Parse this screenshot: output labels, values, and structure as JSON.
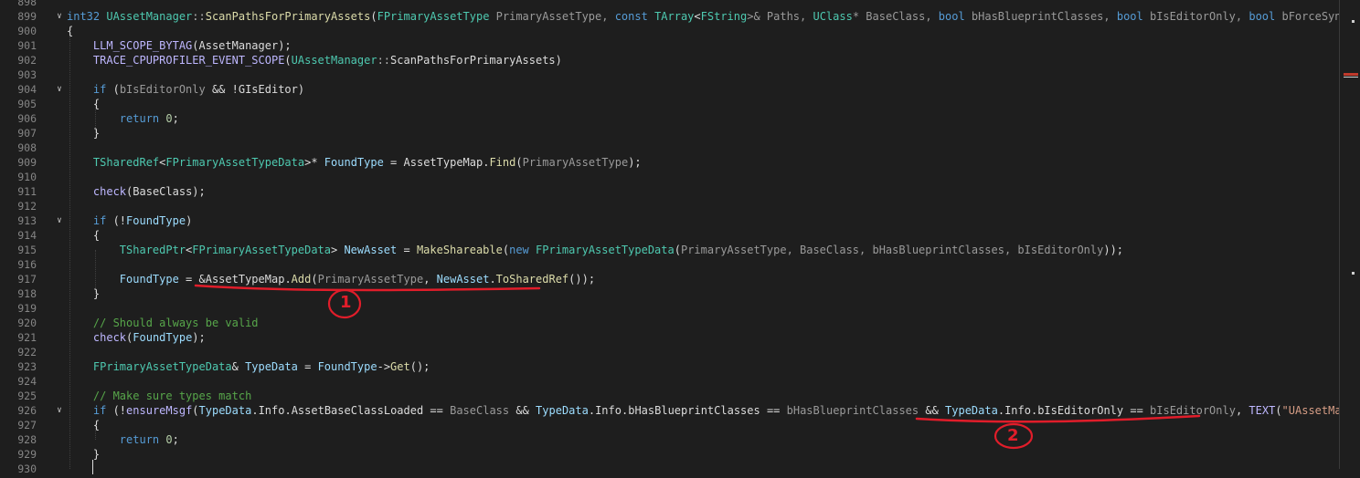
{
  "colors": {
    "background": "#1e1e1e",
    "annotation": "#e11d2a"
  },
  "editor": {
    "line_numbers": [
      "898",
      "899",
      "900",
      "901",
      "902",
      "903",
      "904",
      "905",
      "906",
      "907",
      "908",
      "909",
      "910",
      "911",
      "912",
      "913",
      "914",
      "915",
      "916",
      "917",
      "918",
      "919",
      "920",
      "921",
      "922",
      "923",
      "924",
      "925",
      "926",
      "927",
      "928",
      "929",
      "930"
    ],
    "lines": {
      "l899": {
        "t1": "int32",
        "t2": "UAssetManager",
        "t3": "::",
        "t4": "ScanPathsForPrimaryAssets",
        "t5": "(",
        "t6": "FPrimaryAssetType",
        "t7": " PrimaryAssetType, ",
        "t8": "const",
        "t9": " ",
        "t10": "TArray",
        "t11": "<",
        "t12": "FString",
        "t13": ">& Paths, ",
        "t14": "UClass",
        "t15": "* BaseClass, ",
        "t16": "bool",
        "t17": " bHasBlueprintClasses, ",
        "t18": "bool",
        "t19": " bIsEditorOnly, ",
        "t20": "bool",
        "t21": " bForceSynchrono"
      },
      "l900": {
        "t1": "{"
      },
      "l901": {
        "t1": "LLM_SCOPE_BYTAG",
        "t2": "(AssetManager);"
      },
      "l902": {
        "t1": "TRACE_CPUPROFILER_EVENT_SCOPE",
        "t2": "(",
        "t3": "UAssetManager",
        "t4": "::",
        "t5": "ScanPathsForPrimaryAssets",
        "t6": ")"
      },
      "l904": {
        "t1": "if",
        "t2": " (",
        "t3": "bIsEditorOnly",
        "t4": " && !",
        "t5": "GIsEditor",
        "t6": ")"
      },
      "l905": {
        "t1": "{"
      },
      "l906": {
        "t1": "return",
        "t2": " ",
        "t3": "0",
        "t4": ";"
      },
      "l907": {
        "t1": "}"
      },
      "l909": {
        "t1": "TSharedRef",
        "t2": "<",
        "t3": "FPrimaryAssetTypeData",
        "t4": ">* ",
        "t5": "FoundType",
        "t6": " = ",
        "t7": "AssetTypeMap",
        "t8": ".",
        "t9": "Find",
        "t10": "(",
        "t11": "PrimaryAssetType",
        "t12": ");"
      },
      "l911": {
        "t1": "check",
        "t2": "(",
        "t3": "BaseClass",
        "t4": ");"
      },
      "l913": {
        "t1": "if",
        "t2": " (!",
        "t3": "FoundType",
        "t4": ")"
      },
      "l914": {
        "t1": "{"
      },
      "l915": {
        "t1": "TSharedPtr",
        "t2": "<",
        "t3": "FPrimaryAssetTypeData",
        "t4": "> ",
        "t5": "NewAsset",
        "t6": " = ",
        "t7": "MakeShareable",
        "t8": "(",
        "t9": "new",
        "t10": " ",
        "t11": "FPrimaryAssetTypeData",
        "t12": "(",
        "t13": "PrimaryAssetType, BaseClass, bHasBlueprintClasses, bIsEditorOnly",
        "t14": "));"
      },
      "l917": {
        "t1": "FoundType",
        "t2": " = &",
        "t3": "AssetTypeMap",
        "t4": ".",
        "t5": "Add",
        "t6": "(",
        "t7": "PrimaryAssetType",
        "t8": ", ",
        "t9": "NewAsset",
        "t10": ".",
        "t11": "ToSharedRef",
        "t12": "());"
      },
      "l918": {
        "t1": "}"
      },
      "l920": {
        "t1": "// Should always be valid"
      },
      "l921": {
        "t1": "check",
        "t2": "(",
        "t3": "FoundType",
        "t4": ");"
      },
      "l923": {
        "t1": "FPrimaryAssetTypeData",
        "t2": "& ",
        "t3": "TypeData",
        "t4": " = ",
        "t5": "FoundType",
        "t6": "->",
        "t7": "Get",
        "t8": "();"
      },
      "l925": {
        "t1": "// Make sure types match"
      },
      "l926": {
        "t1": "if",
        "t2": " (!",
        "t3": "ensureMsgf",
        "t4": "(",
        "t5": "TypeData",
        "t6": ".",
        "t7": "Info",
        "t8": ".",
        "t9": "AssetBaseClassLoaded",
        "t10": " == ",
        "t11": "BaseClass",
        "t12": " && ",
        "t13": "TypeData",
        "t14": ".",
        "t15": "Info",
        "t16": ".",
        "t17": "bHasBlueprintClasses",
        "t18": " == ",
        "t19": "bHasBlueprintClasses",
        "t20": " && ",
        "t21": "TypeData",
        "t22": ".",
        "t23": "Info",
        "t24": ".",
        "t25": "bIsEditorOnly",
        "t26": " == ",
        "t27": "bIsEditorOnly",
        "t28": ", ",
        "t29": "TEXT",
        "t30": "(",
        "t31": "\"UAssetManager:"
      },
      "l927": {
        "t1": "{"
      },
      "l928": {
        "t1": "return",
        "t2": " ",
        "t3": "0",
        "t4": ";"
      },
      "l929": {
        "t1": "}"
      }
    }
  },
  "annotations": [
    {
      "label": "1"
    },
    {
      "label": "2"
    }
  ]
}
